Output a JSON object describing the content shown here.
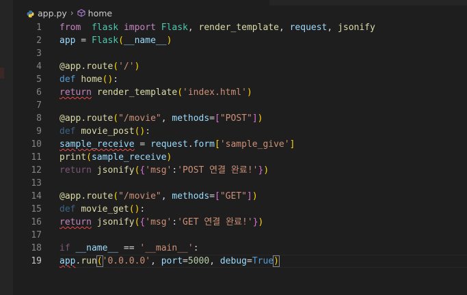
{
  "breadcrumb": {
    "file": "app.py",
    "symbol": "home"
  },
  "editor": {
    "current_line": 19,
    "lines": [
      {
        "n": "1"
      },
      {
        "n": "2"
      },
      {
        "n": "3"
      },
      {
        "n": "4"
      },
      {
        "n": "5"
      },
      {
        "n": "6"
      },
      {
        "n": "7"
      },
      {
        "n": "8"
      },
      {
        "n": "9"
      },
      {
        "n": "10"
      },
      {
        "n": "11"
      },
      {
        "n": "12"
      },
      {
        "n": "13"
      },
      {
        "n": "14"
      },
      {
        "n": "15"
      },
      {
        "n": "16"
      },
      {
        "n": "17"
      },
      {
        "n": "18"
      },
      {
        "n": "19"
      }
    ],
    "code": [
      [
        [
          "kw",
          "from"
        ],
        [
          "",
          "  "
        ],
        [
          "cls",
          "flask"
        ],
        [
          "",
          " "
        ],
        [
          "kw",
          "import"
        ],
        [
          "",
          " "
        ],
        [
          "cls",
          "Flask"
        ],
        [
          "",
          ", "
        ],
        [
          "fn",
          "render_template"
        ],
        [
          "",
          ", "
        ],
        [
          "var",
          "request"
        ],
        [
          "",
          ", "
        ],
        [
          "fn",
          "jsonify"
        ]
      ],
      [
        [
          "var",
          "app"
        ],
        [
          "",
          " = "
        ],
        [
          "cls",
          "Flask"
        ],
        [
          "br1",
          "("
        ],
        [
          "var",
          "__name__"
        ],
        [
          "br1",
          ")"
        ]
      ],
      [],
      [
        [
          "fn",
          "@app"
        ],
        [
          "fn",
          "."
        ],
        [
          "fn",
          "route"
        ],
        [
          "br1",
          "("
        ],
        [
          "str",
          "'/'"
        ],
        [
          "br1",
          ")"
        ]
      ],
      [
        [
          "kw2",
          "def"
        ],
        [
          "",
          " "
        ],
        [
          "fn",
          "home"
        ],
        [
          "br1",
          "("
        ],
        [
          "br1",
          ")"
        ],
        [
          "",
          ":"
        ]
      ],
      [
        [
          "kw sq",
          "return"
        ],
        [
          "",
          " "
        ],
        [
          "fn",
          "render_template"
        ],
        [
          "br1",
          "("
        ],
        [
          "str",
          "'index.html'"
        ],
        [
          "br1",
          ")"
        ]
      ],
      [],
      [
        [
          "fn",
          "@app"
        ],
        [
          "fn",
          "."
        ],
        [
          "fn",
          "route"
        ],
        [
          "br1",
          "("
        ],
        [
          "str",
          "\"/movie\""
        ],
        [
          "",
          ", "
        ],
        [
          "var",
          "methods"
        ],
        [
          "",
          "="
        ],
        [
          "br2",
          "["
        ],
        [
          "str",
          "\"POST\""
        ],
        [
          "br2",
          "]"
        ],
        [
          "br1",
          ")"
        ]
      ],
      [
        [
          "kw2 dm",
          "def"
        ],
        [
          "",
          " "
        ],
        [
          "fn",
          "movie_post"
        ],
        [
          "br1",
          "("
        ],
        [
          "br1",
          ")"
        ],
        [
          "",
          ":"
        ]
      ],
      [
        [
          "var sq",
          "sample_receive"
        ],
        [
          "",
          " = "
        ],
        [
          "var",
          "request"
        ],
        [
          "",
          "."
        ],
        [
          "var",
          "form"
        ],
        [
          "br1",
          "["
        ],
        [
          "str",
          "'sample_give'"
        ],
        [
          "br1",
          "]"
        ]
      ],
      [
        [
          "fn",
          "print"
        ],
        [
          "br1",
          "("
        ],
        [
          "var",
          "sample_receive"
        ],
        [
          "br1",
          ")"
        ]
      ],
      [
        [
          "kw dm",
          "return"
        ],
        [
          "",
          " "
        ],
        [
          "fn",
          "jsonify"
        ],
        [
          "br1",
          "("
        ],
        [
          "br2",
          "{"
        ],
        [
          "str",
          "'msg'"
        ],
        [
          "",
          ":"
        ],
        [
          "str",
          "'POST 연결 완료!'"
        ],
        [
          "br2",
          "}"
        ],
        [
          "br1",
          ")"
        ]
      ],
      [],
      [
        [
          "fn",
          "@app"
        ],
        [
          "fn",
          "."
        ],
        [
          "fn",
          "route"
        ],
        [
          "br1",
          "("
        ],
        [
          "str",
          "\"/movie\""
        ],
        [
          "",
          ", "
        ],
        [
          "var",
          "methods"
        ],
        [
          "",
          "="
        ],
        [
          "br2",
          "["
        ],
        [
          "str",
          "\"GET\""
        ],
        [
          "br2",
          "]"
        ],
        [
          "br1",
          ")"
        ]
      ],
      [
        [
          "kw2 dm",
          "def"
        ],
        [
          "",
          " "
        ],
        [
          "fn",
          "movie_get"
        ],
        [
          "br1",
          "("
        ],
        [
          "br1",
          ")"
        ],
        [
          "",
          ":"
        ]
      ],
      [
        [
          "kw sq",
          "return"
        ],
        [
          "",
          " "
        ],
        [
          "fn",
          "jsonify"
        ],
        [
          "br1",
          "("
        ],
        [
          "br2",
          "{"
        ],
        [
          "str",
          "'msg'"
        ],
        [
          "",
          ":"
        ],
        [
          "str",
          "'GET 연결 완료!'"
        ],
        [
          "br2",
          "}"
        ],
        [
          "br1",
          ")"
        ]
      ],
      [],
      [
        [
          "kw dm",
          "if"
        ],
        [
          "",
          " "
        ],
        [
          "var",
          "__name__"
        ],
        [
          "",
          " == "
        ],
        [
          "str",
          "'__main__'"
        ],
        [
          "",
          ":"
        ]
      ],
      [
        [
          "var sq",
          "app"
        ],
        [
          "",
          "."
        ],
        [
          "fn",
          "run"
        ],
        [
          "br1 bm",
          "("
        ],
        [
          "str",
          "'0.0.0.0'"
        ],
        [
          "",
          ", "
        ],
        [
          "var",
          "port"
        ],
        [
          "",
          "="
        ],
        [
          "num",
          "5000"
        ],
        [
          "",
          ", "
        ],
        [
          "var",
          "debug"
        ],
        [
          "",
          "="
        ],
        [
          "kw2",
          "True"
        ],
        [
          "br1 bm",
          ")"
        ]
      ]
    ]
  },
  "colors": {
    "background": "#1e1e1e",
    "keyword": "#c586c0",
    "function": "#dcdcaa",
    "string": "#ce9178",
    "variable": "#9cdcfe"
  }
}
